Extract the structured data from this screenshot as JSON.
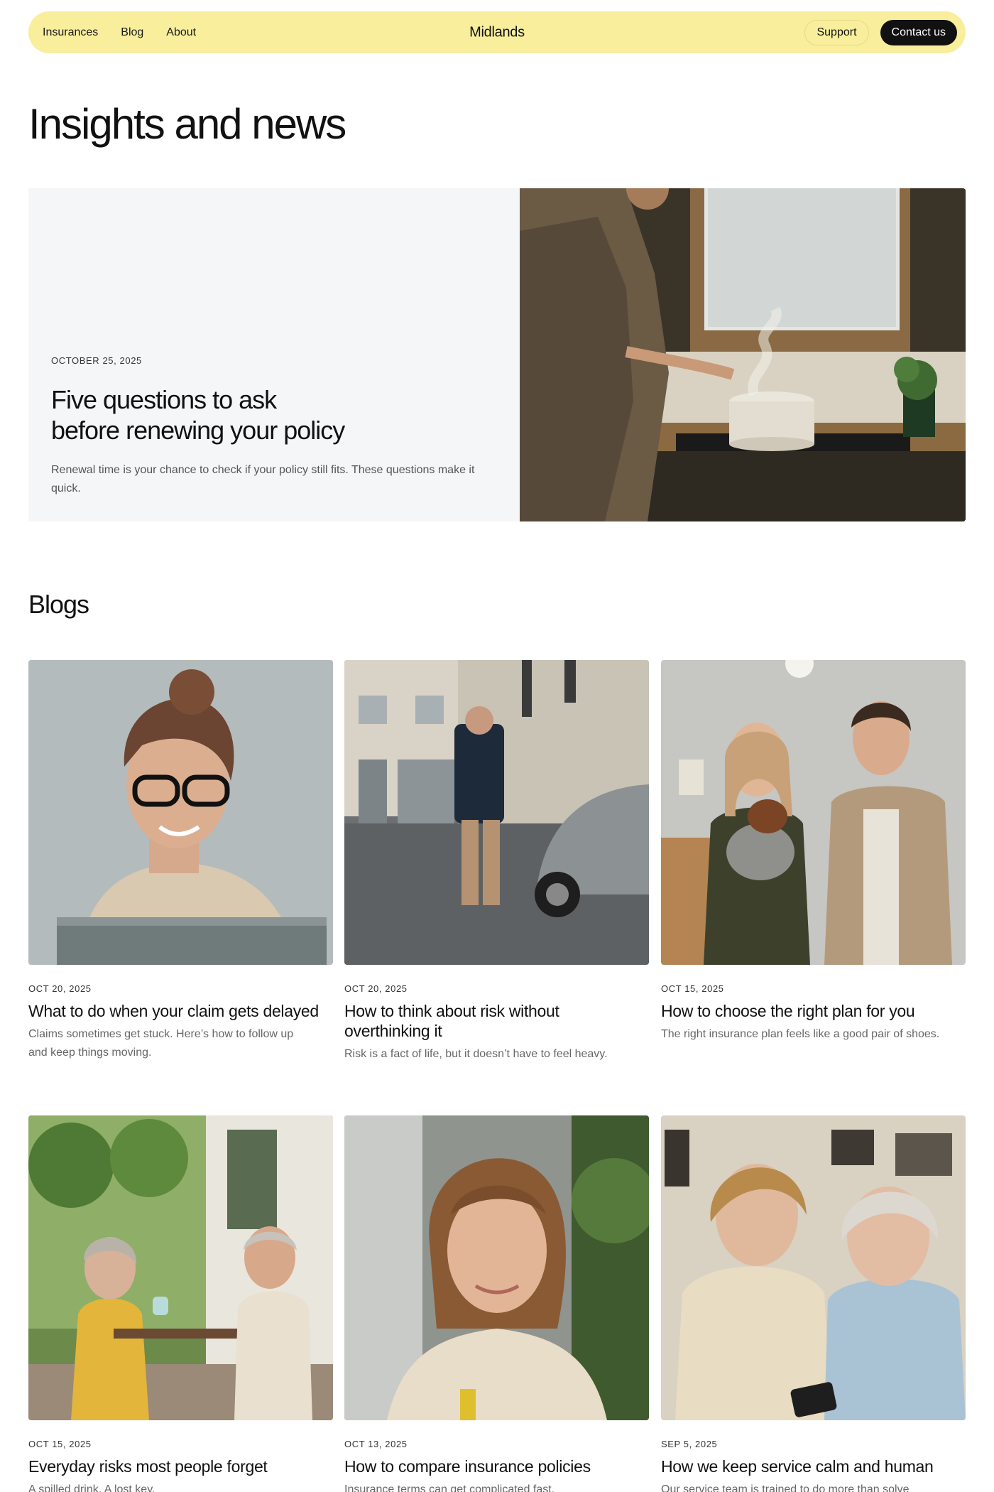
{
  "nav": {
    "links": [
      "Insurances",
      "Blog",
      "About"
    ],
    "brand": "Midlands",
    "support_label": "Support",
    "contact_label": "Contact us"
  },
  "page": {
    "title": "Insights and news"
  },
  "featured": {
    "date": "OCTOBER 25, 2025",
    "title_line1": "Five questions to ask",
    "title_line2": "before renewing your policy",
    "excerpt": "Renewal time is your chance to check if your policy still fits. These questions make it quick."
  },
  "blogs": {
    "heading": "Blogs",
    "posts": [
      {
        "date": "OCT 20, 2025",
        "title": "What to do when your claim gets delayed",
        "excerpt": "Claims sometimes get stuck. Here’s how to follow up and keep things moving."
      },
      {
        "date": "OCT 20, 2025",
        "title": "How to think about risk without overthinking it",
        "excerpt": "Risk is a fact of life, but it doesn’t have to feel heavy."
      },
      {
        "date": "OCT 15, 2025",
        "title": "How to choose the right plan for you",
        "excerpt": "The right insurance plan feels like a good pair of shoes."
      },
      {
        "date": "OCT 15, 2025",
        "title": "Everyday risks most people forget",
        "excerpt": "A spilled drink. A lost key."
      },
      {
        "date": "OCT 13, 2025",
        "title": "How to compare insurance policies",
        "excerpt": "Insurance terms can get complicated fast."
      },
      {
        "date": "SEP 5, 2025",
        "title": "How we keep service calm and human",
        "excerpt": "Our service team is trained to do more than solve"
      }
    ]
  },
  "colors": {
    "nav_bg": "#f8ee9c",
    "contact_bg": "#111111",
    "featured_bg": "#f5f6f7"
  }
}
